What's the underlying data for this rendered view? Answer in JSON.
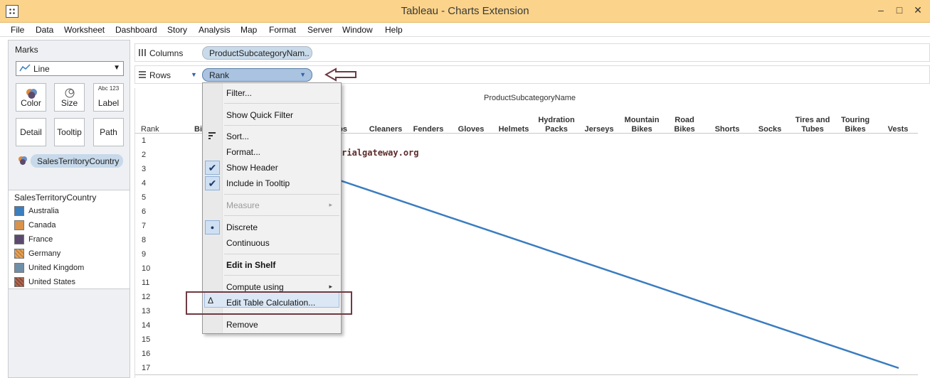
{
  "window": {
    "title": "Tableau - Charts Extension",
    "minimize": "–",
    "maximize": "□",
    "close": "✕"
  },
  "menu": [
    "File",
    "Data",
    "Worksheet",
    "Dashboard",
    "Story",
    "Analysis",
    "Map",
    "Format",
    "Server",
    "Window",
    "Help"
  ],
  "marks": {
    "title": "Marks",
    "mark_type": "Line",
    "buttons": {
      "color": "Color",
      "size": "Size",
      "label": "Label",
      "detail": "Detail",
      "tooltip": "Tooltip",
      "path": "Path"
    },
    "label_icon_text": "Abc 123",
    "color_field": "SalesTerritoryCountry"
  },
  "legend": {
    "title": "SalesTerritoryCountry",
    "items": [
      {
        "label": "Australia",
        "color": "#3b7fbf"
      },
      {
        "label": "Canada",
        "color": "#d9924a"
      },
      {
        "label": "France",
        "color": "#5b4a6e"
      },
      {
        "label": "Germany",
        "color": "#c8813a"
      },
      {
        "label": "United Kingdom",
        "color": "#6f8fa8"
      },
      {
        "label": "United States",
        "color": "#8a4a3a"
      }
    ]
  },
  "shelves": {
    "columns_label": "Columns",
    "columns_pill": "ProductSubcategoryNam..",
    "rows_label": "Rows",
    "rows_pill": "Rank"
  },
  "view": {
    "column_title": "ProductSubcategoryName",
    "rank_header": "Rank",
    "column_headers": [
      "Bi",
      "aps",
      "Cleaners",
      "Fenders",
      "Gloves",
      "Helmets",
      "Hydration Packs",
      "Jerseys",
      "Mountain Bikes",
      "Road Bikes",
      "Shorts",
      "Socks",
      "Tires and Tubes",
      "Touring Bikes",
      "Vests"
    ],
    "ranks": [
      "1",
      "2",
      "3",
      "4",
      "5",
      "6",
      "7",
      "8",
      "9",
      "10",
      "11",
      "12",
      "13",
      "14",
      "15",
      "16",
      "17"
    ],
    "watermark": "©tutorialgateway.org",
    "line_color": "#3a7cc0"
  },
  "context_menu": {
    "filter": "Filter...",
    "show_quick_filter": "Show Quick Filter",
    "sort": "Sort...",
    "format": "Format...",
    "show_header": "Show Header",
    "include_in_tooltip": "Include in Tooltip",
    "measure": "Measure",
    "discrete": "Discrete",
    "continuous": "Continuous",
    "edit_in_shelf": "Edit in Shelf",
    "compute_using": "Compute using",
    "edit_table_calculation": "Edit Table Calculation...",
    "remove": "Remove",
    "check_mark": "✔",
    "radio_mark": "●",
    "delta_mark": "Δ",
    "submenu_mark": "▸"
  }
}
